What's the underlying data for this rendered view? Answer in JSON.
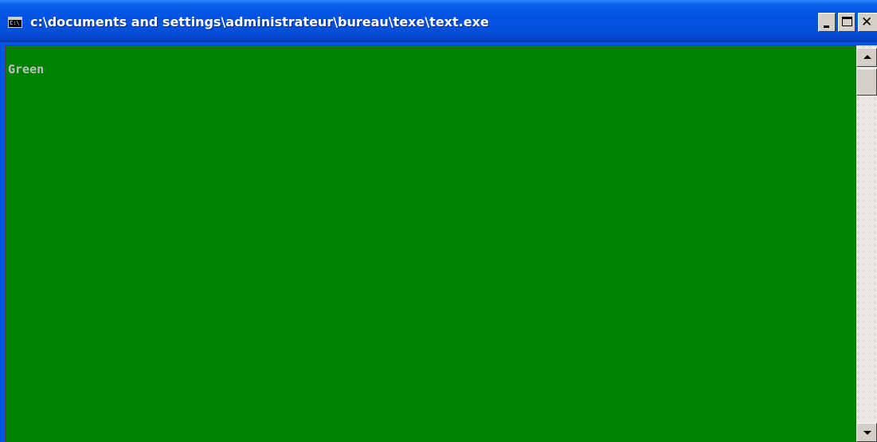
{
  "window": {
    "title": "c:\\documents and settings\\administrateur\\bureau\\texe\\text.exe",
    "icon_text": "C:\\"
  },
  "console": {
    "output_line": "Green"
  },
  "icons": {
    "app": "console-app-icon",
    "minimize": "minimize-icon",
    "maximize": "maximize-icon",
    "close": "close-icon",
    "scroll_up": "arrow-up-icon",
    "scroll_down": "arrow-down-icon"
  },
  "colors": {
    "titlebar": "#0054e3",
    "console_background": "#008000",
    "console_text": "#c0c0c0",
    "button_face": "#d4d0c8"
  }
}
